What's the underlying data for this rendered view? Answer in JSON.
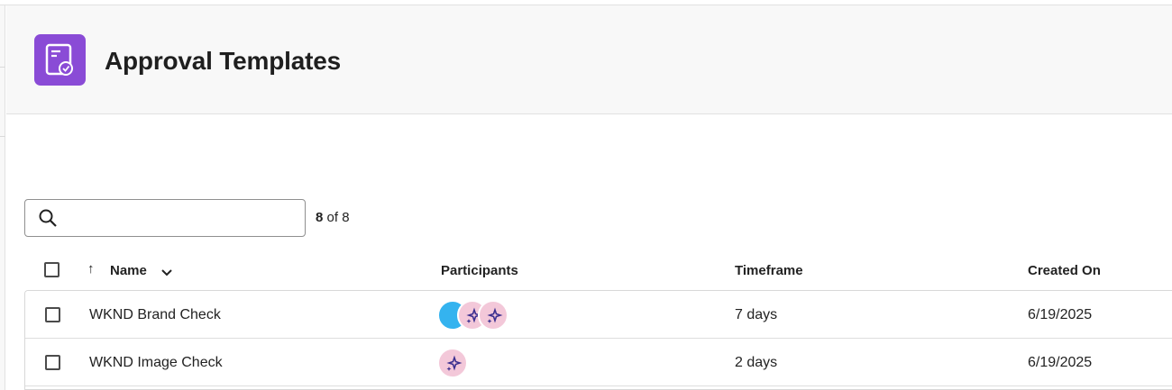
{
  "header": {
    "title": "Approval Templates",
    "icon": "approval-template-icon",
    "accent_color": "#8a4bd6"
  },
  "search": {
    "value": "",
    "placeholder": "",
    "icon": "search-icon"
  },
  "results": {
    "shown": "8",
    "separator": " of ",
    "total": "8"
  },
  "table": {
    "columns": {
      "name": "Name",
      "participants": "Participants",
      "timeframe": "Timeframe",
      "created": "Created On"
    },
    "sort": {
      "column": "Name",
      "icon_up": "arrow-up-icon",
      "icon_menu": "chevron-down-icon"
    },
    "rows": [
      {
        "name": "WKND Brand Check",
        "participants": [
          "blue-avatar",
          "sparkle-avatar",
          "sparkle-avatar"
        ],
        "timeframe": "7 days",
        "created": "6/19/2025"
      },
      {
        "name": "WKND Image Check",
        "participants": [
          "sparkle-avatar"
        ],
        "timeframe": "2 days",
        "created": "6/19/2025"
      }
    ]
  }
}
